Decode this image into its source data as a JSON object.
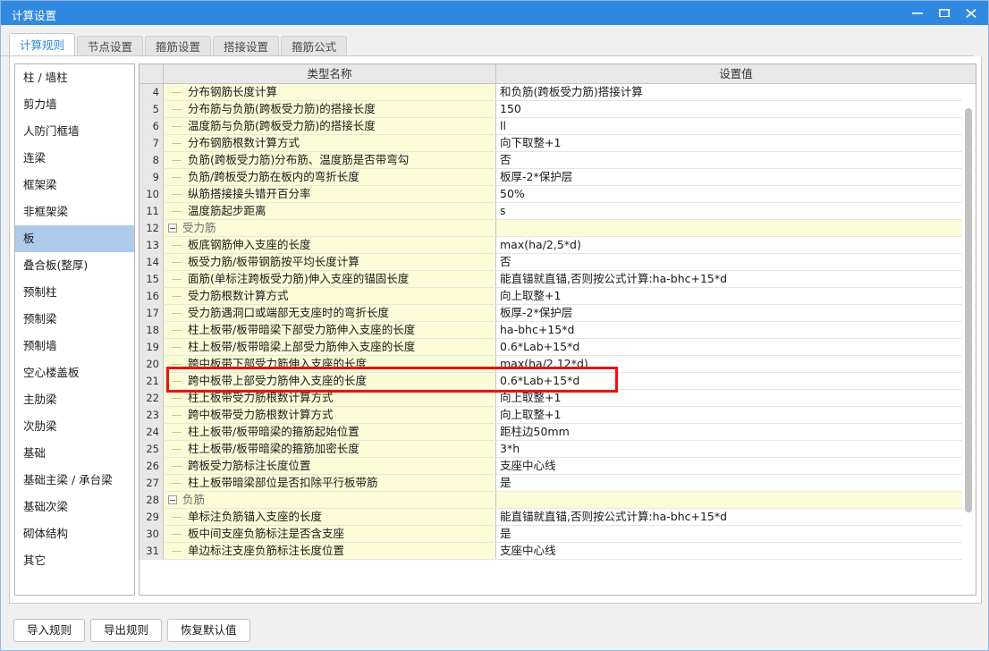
{
  "window": {
    "title": "计算设置",
    "titlebar_color": "#3089e0",
    "controls": [
      {
        "name": "minimize",
        "glyph": "minimize-icon"
      },
      {
        "name": "maximize",
        "glyph": "maximize-icon"
      },
      {
        "name": "close",
        "glyph": "close-icon"
      }
    ]
  },
  "tabs": [
    {
      "label": "计算规则",
      "active": true
    },
    {
      "label": "节点设置",
      "active": false
    },
    {
      "label": "箍筋设置",
      "active": false
    },
    {
      "label": "搭接设置",
      "active": false
    },
    {
      "label": "箍筋公式",
      "active": false
    }
  ],
  "sidebar": {
    "selected": "板",
    "items": [
      {
        "label": "柱 / 墙柱"
      },
      {
        "label": "剪力墙"
      },
      {
        "label": "人防门框墙"
      },
      {
        "label": "连梁"
      },
      {
        "label": "框架梁"
      },
      {
        "label": "非框架梁"
      },
      {
        "label": "板"
      },
      {
        "label": "叠合板(整厚)"
      },
      {
        "label": "预制柱"
      },
      {
        "label": "预制梁"
      },
      {
        "label": "预制墙"
      },
      {
        "label": "空心楼盖板"
      },
      {
        "label": "主肋梁"
      },
      {
        "label": "次肋梁"
      },
      {
        "label": "基础"
      },
      {
        "label": "基础主梁 / 承台梁"
      },
      {
        "label": "基础次梁"
      },
      {
        "label": "砌体结构"
      },
      {
        "label": "其它"
      }
    ]
  },
  "grid": {
    "columns": [
      "",
      "类型名称",
      "设置值"
    ],
    "rows": [
      {
        "num": "4",
        "name": "分布钢筋长度计算",
        "value": "和负筋(跨板受力筋)搭接计算",
        "group": false
      },
      {
        "num": "5",
        "name": "分布筋与负筋(跨板受力筋)的搭接长度",
        "value": "150",
        "group": false
      },
      {
        "num": "6",
        "name": "温度筋与负筋(跨板受力筋)的搭接长度",
        "value": "ll",
        "group": false
      },
      {
        "num": "7",
        "name": "分布钢筋根数计算方式",
        "value": "向下取整+1",
        "group": false
      },
      {
        "num": "8",
        "name": "负筋(跨板受力筋)分布筋、温度筋是否带弯勾",
        "value": "否",
        "group": false
      },
      {
        "num": "9",
        "name": "负筋/跨板受力筋在板内的弯折长度",
        "value": "板厚-2*保护层",
        "group": false
      },
      {
        "num": "10",
        "name": "纵筋搭接接头错开百分率",
        "value": "50%",
        "group": false
      },
      {
        "num": "11",
        "name": "温度筋起步距离",
        "value": "s",
        "group": false
      },
      {
        "num": "12",
        "name": "受力筋",
        "value": "",
        "group": true
      },
      {
        "num": "13",
        "name": "板底钢筋伸入支座的长度",
        "value": "max(ha/2,5*d)",
        "group": false
      },
      {
        "num": "14",
        "name": "板受力筋/板带钢筋按平均长度计算",
        "value": "否",
        "group": false
      },
      {
        "num": "15",
        "name": "面筋(单标注跨板受力筋)伸入支座的锚固长度",
        "value": "能直锚就直锚,否则按公式计算:ha-bhc+15*d",
        "group": false
      },
      {
        "num": "16",
        "name": "受力筋根数计算方式",
        "value": "向上取整+1",
        "group": false,
        "highlighted": true
      },
      {
        "num": "17",
        "name": "受力筋遇洞口或端部无支座时的弯折长度",
        "value": "板厚-2*保护层",
        "group": false
      },
      {
        "num": "18",
        "name": "柱上板带/板带暗梁下部受力筋伸入支座的长度",
        "value": "ha-bhc+15*d",
        "group": false
      },
      {
        "num": "19",
        "name": "柱上板带/板带暗梁上部受力筋伸入支座的长度",
        "value": "0.6*Lab+15*d",
        "group": false
      },
      {
        "num": "20",
        "name": "跨中板带下部受力筋伸入支座的长度",
        "value": "max(ha/2,12*d)",
        "group": false
      },
      {
        "num": "21",
        "name": "跨中板带上部受力筋伸入支座的长度",
        "value": "0.6*Lab+15*d",
        "group": false
      },
      {
        "num": "22",
        "name": "柱上板带受力筋根数计算方式",
        "value": "向上取整+1",
        "group": false
      },
      {
        "num": "23",
        "name": "跨中板带受力筋根数计算方式",
        "value": "向上取整+1",
        "group": false
      },
      {
        "num": "24",
        "name": "柱上板带/板带暗梁的箍筋起始位置",
        "value": "距柱边50mm",
        "group": false
      },
      {
        "num": "25",
        "name": "柱上板带/板带暗梁的箍筋加密长度",
        "value": "3*h",
        "group": false
      },
      {
        "num": "26",
        "name": "跨板受力筋标注长度位置",
        "value": "支座中心线",
        "group": false
      },
      {
        "num": "27",
        "name": "柱上板带暗梁部位是否扣除平行板带筋",
        "value": "是",
        "group": false
      },
      {
        "num": "28",
        "name": "负筋",
        "value": "",
        "group": true
      },
      {
        "num": "29",
        "name": "单标注负筋锚入支座的长度",
        "value": "能直锚就直锚,否则按公式计算:ha-bhc+15*d",
        "group": false
      },
      {
        "num": "30",
        "name": "板中间支座负筋标注是否含支座",
        "value": "是",
        "group": false
      },
      {
        "num": "31",
        "name": "单边标注支座负筋标注长度位置",
        "value": "支座中心线",
        "group": false
      }
    ]
  },
  "footer": {
    "buttons": [
      {
        "label": "导入规则"
      },
      {
        "label": "导出规则"
      },
      {
        "label": "恢复默认值"
      }
    ]
  },
  "annotation": {
    "highlight_color": "#ee1111",
    "highlight_row": "16"
  }
}
